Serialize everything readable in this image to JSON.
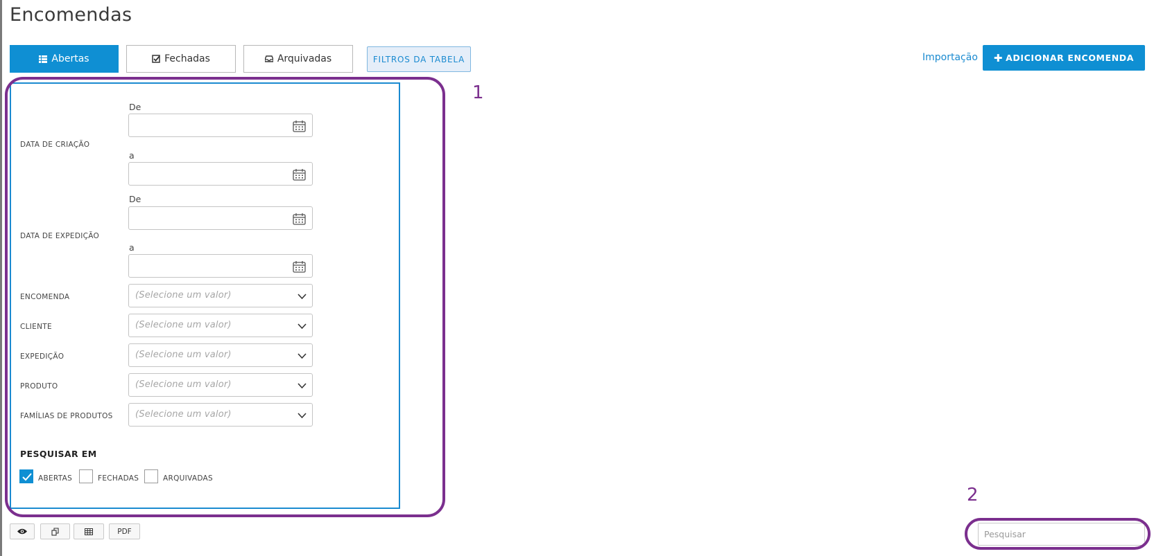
{
  "page": {
    "title": "Encomendas"
  },
  "tabs": [
    {
      "label": "Abertas",
      "icon": "list-icon",
      "active": true
    },
    {
      "label": "Fechadas",
      "icon": "check-square-icon",
      "active": false
    },
    {
      "label": "Arquivadas",
      "icon": "inbox-icon",
      "active": false
    }
  ],
  "filters_button": {
    "label": "FILTROS DA TABELA"
  },
  "header_actions": {
    "import_label": "Importação",
    "add_label": "ADICIONAR ENCOMENDA",
    "add_icon": "plus-icon"
  },
  "filters": {
    "creation_date": {
      "label": "DATA DE CRIAÇÃO",
      "from_caption": "De",
      "to_caption": "a",
      "from_value": "",
      "to_value": ""
    },
    "shipping_date": {
      "label": "DATA DE EXPEDIÇÃO",
      "from_caption": "De",
      "to_caption": "a",
      "from_value": "",
      "to_value": ""
    },
    "selects": [
      {
        "label": "ENCOMENDA",
        "placeholder": "(Selecione um valor)"
      },
      {
        "label": "CLIENTE",
        "placeholder": "(Selecione um valor)"
      },
      {
        "label": "EXPEDIÇÃO",
        "placeholder": "(Selecione um valor)"
      },
      {
        "label": "PRODUTO",
        "placeholder": "(Selecione um valor)"
      },
      {
        "label": "FAMÍLIAS DE PRODUTOS",
        "placeholder": "(Selecione um valor)"
      }
    ],
    "search_in": {
      "title": "PESQUISAR EM",
      "options": [
        {
          "label": "ABERTAS",
          "checked": true
        },
        {
          "label": "FECHADAS",
          "checked": false
        },
        {
          "label": "ARQUIVADAS",
          "checked": false
        }
      ]
    }
  },
  "toolbar": {
    "pdf_label": "PDF",
    "icons": [
      "eye-icon",
      "copy-icon",
      "table-icon"
    ]
  },
  "search": {
    "placeholder": "Pesquisar",
    "value": ""
  },
  "annotations": {
    "callout_1": "1",
    "callout_2": "2"
  },
  "colors": {
    "accent": "#0f8fd3",
    "highlight": "#7b2f8e",
    "filters_bg": "#e5eef9"
  }
}
